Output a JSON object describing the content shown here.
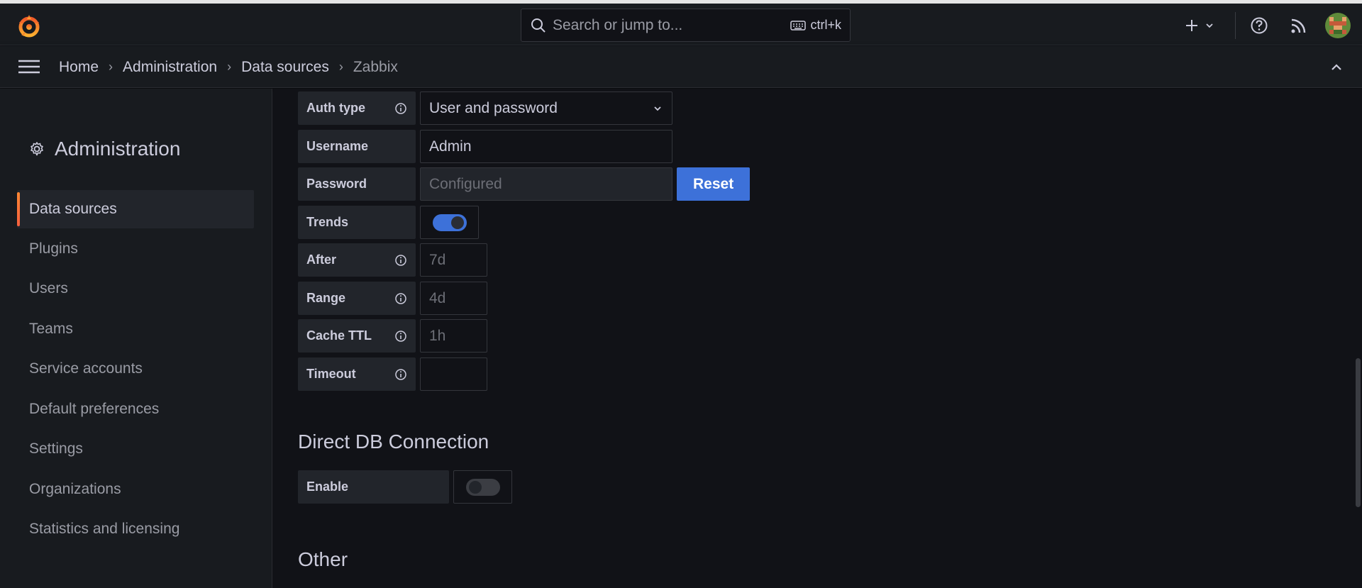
{
  "topbar": {
    "search_placeholder": "Search or jump to...",
    "search_shortcut": "ctrl+k"
  },
  "breadcrumb": {
    "items": [
      "Home",
      "Administration",
      "Data sources",
      "Zabbix"
    ]
  },
  "sidebar": {
    "title": "Administration",
    "items": [
      {
        "label": "Data sources",
        "active": true
      },
      {
        "label": "Plugins"
      },
      {
        "label": "Users"
      },
      {
        "label": "Teams"
      },
      {
        "label": "Service accounts"
      },
      {
        "label": "Default preferences"
      },
      {
        "label": "Settings"
      },
      {
        "label": "Organizations"
      },
      {
        "label": "Statistics and licensing"
      }
    ]
  },
  "form": {
    "auth_type": {
      "label": "Auth type",
      "value": "User and password"
    },
    "username": {
      "label": "Username",
      "value": "Admin"
    },
    "password": {
      "label": "Password",
      "placeholder": "Configured",
      "reset_label": "Reset"
    },
    "trends": {
      "label": "Trends",
      "enabled": true
    },
    "after": {
      "label": "After",
      "placeholder": "7d"
    },
    "range": {
      "label": "Range",
      "placeholder": "4d"
    },
    "cache_ttl": {
      "label": "Cache TTL",
      "placeholder": "1h"
    },
    "timeout": {
      "label": "Timeout",
      "value": ""
    }
  },
  "direct_db": {
    "title": "Direct DB Connection",
    "enable": {
      "label": "Enable",
      "enabled": false
    }
  },
  "other": {
    "title": "Other"
  },
  "colors": {
    "accent": "#3d71d9",
    "brand": "#f55f3e",
    "background": "#111217",
    "panel": "#181b1f"
  }
}
